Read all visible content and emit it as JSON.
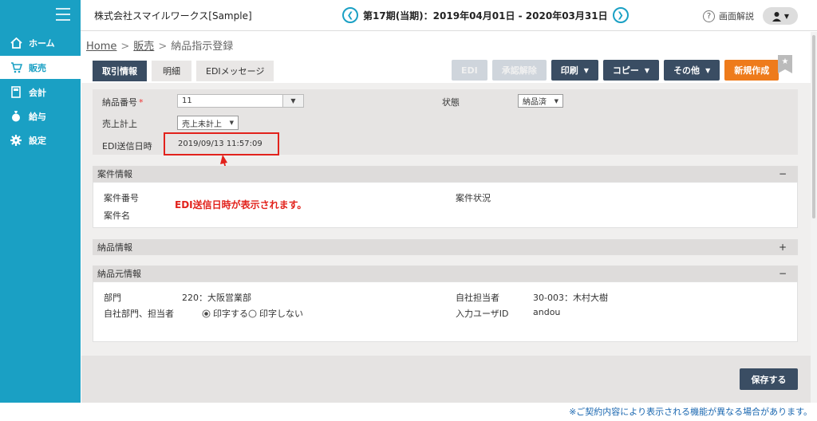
{
  "sidebar": {
    "items": [
      {
        "label": "ホーム",
        "icon": "home-icon"
      },
      {
        "label": "販売",
        "icon": "cart-icon"
      },
      {
        "label": "会計",
        "icon": "calculator-icon"
      },
      {
        "label": "給与",
        "icon": "money-bag-icon"
      },
      {
        "label": "設定",
        "icon": "gear-icon"
      }
    ]
  },
  "header": {
    "company": "株式会社スマイルワークス[Sample]",
    "period": "第17期(当期)：2019年04月01日 - 2020年03月31日",
    "help": "画面解説"
  },
  "breadcrumb": {
    "home": "Home",
    "sales": "販売",
    "current": "納品指示登録"
  },
  "tabs": [
    "取引情報",
    "明細",
    "EDIメッセージ"
  ],
  "toolbar": {
    "edi": "EDI",
    "approve_cancel": "承認解除",
    "print": "印刷",
    "copy": "コピー",
    "other": "その他",
    "new": "新規作成"
  },
  "form": {
    "delivery_no_label": "納品番号",
    "required_mark": "*",
    "delivery_no_value": "11",
    "status_label": "状態",
    "status_value": "納品済",
    "sales_label": "売上計上",
    "sales_value": "売上未計上",
    "edi_sent_label": "EDI送信日時",
    "edi_sent_value": "2019/09/13 11:57:09"
  },
  "annotation": "EDI送信日時が表示されます。",
  "sections": {
    "project": {
      "title": "案件情報",
      "toggle": "−",
      "project_no": "案件番号",
      "project_name": "案件名",
      "project_status": "案件状況"
    },
    "delivery": {
      "title": "納品情報",
      "toggle": "+"
    },
    "source": {
      "title": "納品元情報",
      "toggle": "−",
      "dept_label": "部門",
      "dept_value": "220：大阪営業部",
      "staff_label": "自社担当者",
      "staff_value": "30-003：木村大樹",
      "print_label": "自社部門、担当者",
      "print_yes": "印字する",
      "print_no": "印字しない",
      "user_label": "入力ユーザID",
      "user_value": "andou"
    }
  },
  "save_label": "保存する",
  "footer_note": "※ご契約内容により表示される機能が異なる場合があります。"
}
